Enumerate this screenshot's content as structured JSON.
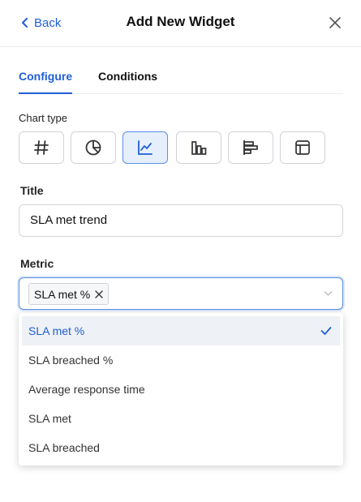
{
  "header": {
    "back_label": "Back",
    "title": "Add New Widget"
  },
  "tabs": [
    {
      "label": "Configure",
      "active": true
    },
    {
      "label": "Conditions",
      "active": false
    }
  ],
  "chart_type": {
    "label": "Chart type",
    "options": [
      {
        "icon": "hash-icon",
        "selected": false
      },
      {
        "icon": "pie-chart-icon",
        "selected": false
      },
      {
        "icon": "line-chart-icon",
        "selected": true
      },
      {
        "icon": "bar-chart-icon",
        "selected": false
      },
      {
        "icon": "horizontal-bar-chart-icon",
        "selected": false
      },
      {
        "icon": "table-icon",
        "selected": false
      }
    ]
  },
  "title_field": {
    "label": "Title",
    "value": "SLA met trend"
  },
  "metric_field": {
    "label": "Metric",
    "selected_chip": "SLA met %"
  },
  "dropdown": {
    "options": [
      {
        "label": "SLA met %",
        "selected": true
      },
      {
        "label": "SLA breached %",
        "selected": false
      },
      {
        "label": "Average response time",
        "selected": false
      },
      {
        "label": "SLA met",
        "selected": false
      },
      {
        "label": "SLA breached",
        "selected": false
      }
    ]
  },
  "colors": {
    "accent": "#1f5fd6",
    "selected_bg": "#e6effc",
    "border": "#cfd3d8"
  }
}
